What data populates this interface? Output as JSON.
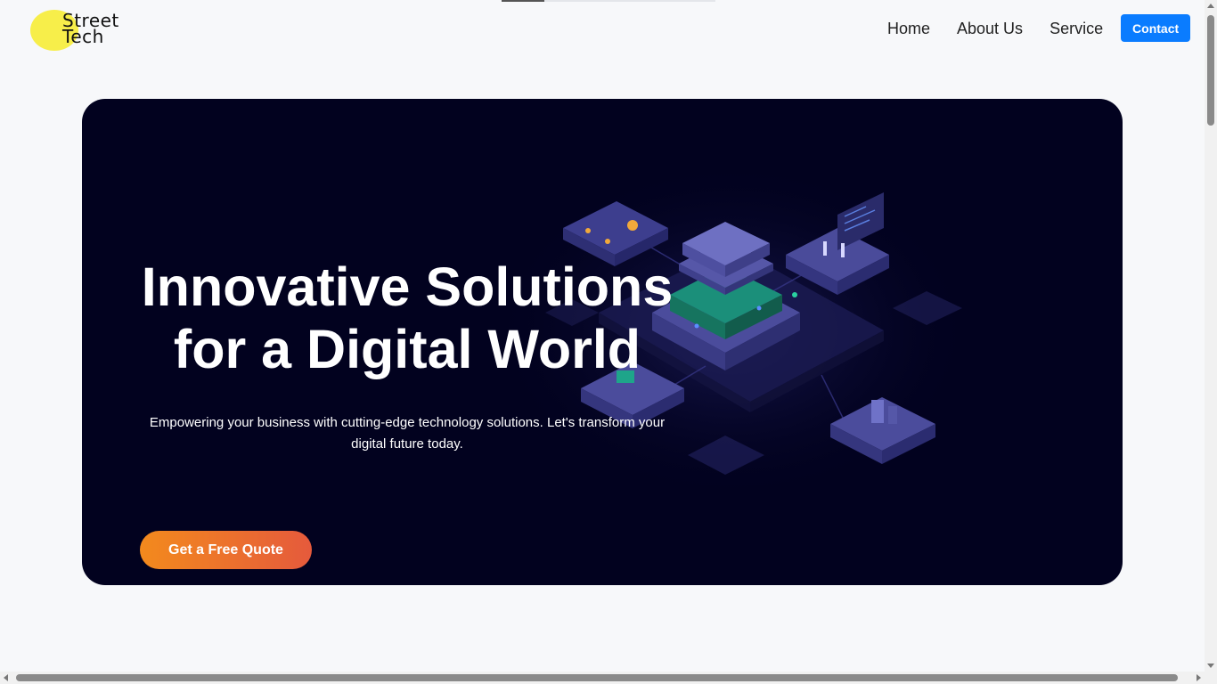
{
  "header": {
    "logo_line1": "Street",
    "logo_line2": "Tech",
    "nav": [
      "Home",
      "About Us",
      "Service"
    ],
    "contact_label": "Contact"
  },
  "hero": {
    "title_line1": "Innovative Solutions",
    "title_line2": "for a Digital World",
    "subtitle": "Empowering your business with cutting-edge technology solutions. Let's transform your digital future today.",
    "cta_label": "Get a Free Quote",
    "illustration_icon": "isometric-tech-illustration"
  },
  "colors": {
    "accent": "#0a7cff",
    "hero_bg": "#02021f",
    "cta_start": "#f38a1d",
    "cta_end": "#e55a3c",
    "logo_dot": "#f7ee4a"
  }
}
